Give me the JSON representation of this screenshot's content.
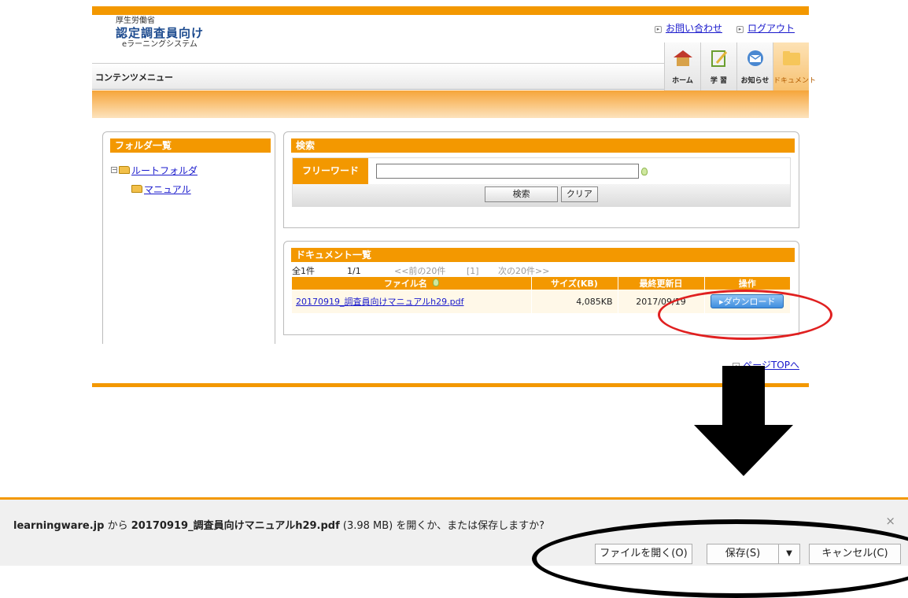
{
  "header": {
    "ministry": "厚生労働省",
    "title": "認定調査員向け",
    "subtitle": "eラーニングシステム",
    "links": {
      "contact": "お問い合わせ",
      "logout": "ログアウト"
    }
  },
  "menubar": {
    "title": "コンテンツメニュー"
  },
  "nav": {
    "home": "ホーム",
    "study": "学 習",
    "notice": "お知らせ",
    "document": "ドキュメント"
  },
  "folder_panel": {
    "heading": "フォルダ一覧",
    "root": "ルートフォルダ",
    "child": "マニュアル"
  },
  "search_panel": {
    "heading": "検索",
    "label": "フリーワード",
    "input_value": "",
    "search_button": "検索",
    "clear_button": "クリア"
  },
  "doc_panel": {
    "heading": "ドキュメント一覧",
    "pager": {
      "total": "全1件",
      "page": "1/1",
      "prev": "<<前の20件",
      "pages": "[1]",
      "next": "次の20件>>"
    },
    "columns": [
      "ファイル名",
      "サイズ(KB)",
      "最終更新日",
      "操作"
    ],
    "rows": [
      {
        "file": "20170919_調査員向けマニュアルh29.pdf",
        "size": "4,085KB",
        "date": "2017/09/19",
        "action": "▸ダウンロード"
      }
    ]
  },
  "page_top": "ページTOPへ",
  "download_bar": {
    "host": "learningware.jp",
    "from": " から ",
    "filename": "20170919_調査員向けマニュアルh29.pdf",
    "size": " (3.98 MB) ",
    "question": "を開くか、または保存しますか?",
    "open_button": "ファイルを開く(O)",
    "save_button": "保存(S)",
    "save_dropdown": "▼",
    "cancel_button": "キャンセル(C)",
    "close": "×"
  },
  "colors": {
    "accent": "#f39800",
    "highlight_red": "#e02020",
    "link": "#1a1acc"
  }
}
